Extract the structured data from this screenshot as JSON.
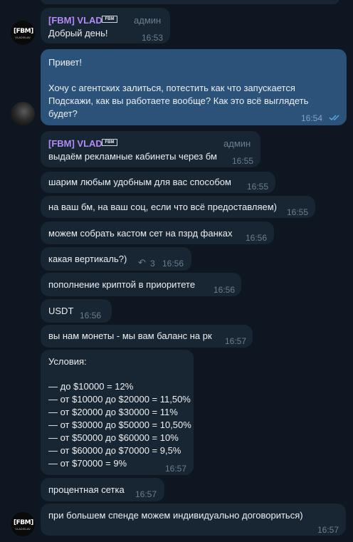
{
  "top_partial": {
    "time": ""
  },
  "msg1": {
    "sender": "[FBM] VLAD",
    "role": "админ",
    "text": "Добрый день!",
    "time": "16:53"
  },
  "msg2": {
    "line1": "Привет!",
    "line2": "Хочу с агентских залиться, потестить как что запускается",
    "line3": "Подскажи, как вы работаете вообще? Как это всё выглядеть",
    "line4": "будет?",
    "time": "16:54"
  },
  "msg3": {
    "sender": "[FBM] VLAD",
    "role": "админ",
    "text": "выдаём рекламные кабинеты через бм",
    "time": "16:55"
  },
  "msg4": {
    "text": "шарим любым удобным для вас способом",
    "time": "16:55"
  },
  "msg5": {
    "text": "на ваш бм, на ваш соц, если что всё предоставляем)",
    "time": "16:55"
  },
  "msg6": {
    "text": "можем собрать кастом сет на пзрд фанках",
    "time": "16:56"
  },
  "msg7": {
    "text": "какая вертикаль?)",
    "replies": "3",
    "time": "16:56"
  },
  "msg8": {
    "text": "пополнение криптой в приоритете",
    "time": "16:56"
  },
  "msg9": {
    "text": "USDT",
    "time": "16:56"
  },
  "msg10": {
    "text": "вы нам монеты - мы вам баланс на рк",
    "time": "16:57"
  },
  "msg11": {
    "title": "Условия:",
    "lines": [
      "— до $10000 = 12%",
      "— от $10000 до $20000 = 11,50%",
      "— от $20000 до $30000 = 11%",
      "— от $30000 до $50000 = 10,50%",
      "— от $50000 до $60000 = 10%",
      "— от $60000 до $70000 = 9,5%",
      "— от $70000 = 9%"
    ],
    "time": "16:57"
  },
  "msg12": {
    "text": "процентная сетка",
    "time": "16:57"
  },
  "msg13": {
    "text": "при большем спенде можем индивидуально договориться)",
    "time": "16:57"
  },
  "avatar": {
    "logo": "[FBM]",
    "sub": "VLADISLAV"
  },
  "badge": "FBM",
  "icons": {
    "read": "double-check-icon",
    "reply": "reply-icon"
  },
  "colors": {
    "bg": "#0e1621",
    "incoming": "#182533",
    "outgoing": "#2b5278",
    "sender": "#b28bf7",
    "meta": "#6d7f8f",
    "check": "#5ea7e5"
  }
}
